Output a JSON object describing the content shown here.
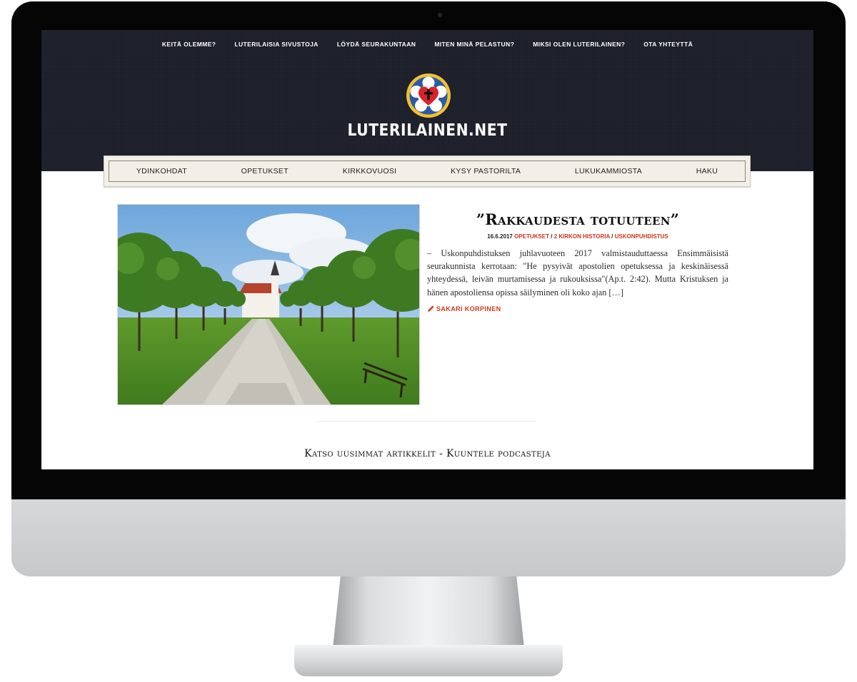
{
  "top_nav": [
    {
      "label": "KEITÄ OLEMME?"
    },
    {
      "label": "LUTERILAISIA SIVUSTOJA"
    },
    {
      "label": "LÖYDÄ SEURAKUNTAAN"
    },
    {
      "label": "MITEN MINÄ PELASTUN?"
    },
    {
      "label": "MIKSI OLEN LUTERILAINEN?"
    },
    {
      "label": "OTA YHTEYTTÄ"
    }
  ],
  "site": {
    "title": "LUTERILAINEN.NET",
    "logo_icon": "luther-rose-icon",
    "colors": {
      "header_bg": "#1c1f2a",
      "accent_red": "#d0361d",
      "nav_bg": "#f1efe8"
    }
  },
  "main_nav": [
    {
      "label": "YDINKOHDAT"
    },
    {
      "label": "OPETUKSET"
    },
    {
      "label": "KIRKKOVUOSI"
    },
    {
      "label": "KYSY PASTORILTA"
    },
    {
      "label": "LUKUKAMMIOSTA"
    },
    {
      "label": "HAKU"
    }
  ],
  "article": {
    "title": "”Rakkaudesta totuuteen”",
    "date": "16.6.2017",
    "categories": [
      "OPETUKSET",
      "2 KIRKON HISTORIA",
      "USKONPUHDISTUS"
    ],
    "separator": "/",
    "excerpt": "– Uskonpuhdistuksen juhlavuoteen 2017 valmistauduttaessa Ensimmäisistä seurakunnista kerrotaan: \"He pysyivät apostolien opetuksessa ja keskinäisessä yhteydessä, leivän murtamisessa ja rukouksissa\"(Ap.t. 2:42). Mutta Kristuksen ja hänen apostoliensa opissa säilyminen oli koko ajan […]",
    "author": "SAKARI KORPINEN",
    "author_icon": "pencil-icon"
  },
  "footer": {
    "latest_articles": "Katso uusimmat artikkelit",
    "separator": "-",
    "podcasts": "Kuuntele podcasteja"
  }
}
